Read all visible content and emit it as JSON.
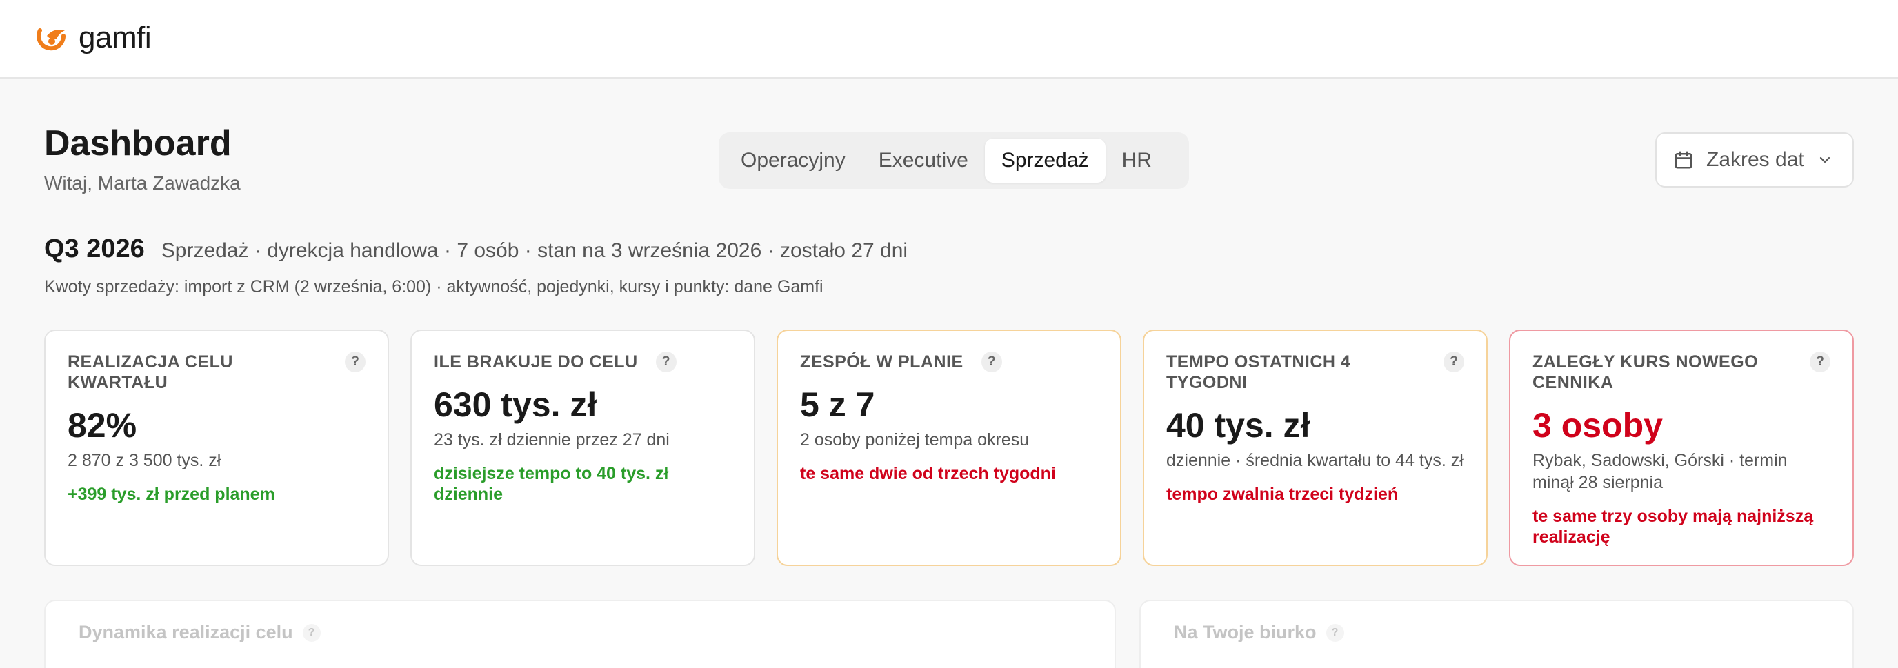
{
  "app": {
    "logo_text": "gamfi",
    "brand_color": "#f07d1a"
  },
  "header": {
    "title": "Dashboard",
    "greeting": "Witaj, Marta Zawadzka"
  },
  "tabs": [
    {
      "label": "Operacyjny",
      "active": false
    },
    {
      "label": "Executive",
      "active": false
    },
    {
      "label": "Sprzedaż",
      "active": true
    },
    {
      "label": "HR",
      "active": false
    }
  ],
  "date_filter": {
    "label": "Zakres dat",
    "icon": "calendar-icon"
  },
  "period": {
    "title": "Q3 2026",
    "meta": "Sprzedaż · dyrekcja handlowa · 7 osób · stan na 3 września 2026 · zostało 27 dni",
    "sources": "Kwoty sprzedaży: import z CRM (2 września, 6:00) · aktywność, pojedynki, kursy i punkty: dane Gamfi"
  },
  "cards": [
    {
      "label": "REALIZACJA CELU KWARTAŁU",
      "value": "82%",
      "sub": "2 870 z 3 500 tys. zł",
      "note": "+399 tys. zł przed planem",
      "tone": "green"
    },
    {
      "label": "ILE BRAKUJE DO CELU",
      "value": "630 tys. zł",
      "sub": "23 tys. zł dziennie przez 27 dni",
      "note": "dzisiejsze tempo to 40 tys. zł dziennie",
      "tone": "green"
    },
    {
      "label": "ZESPÓŁ W PLANIE",
      "value": "5 z 7",
      "sub": "2 osoby poniżej tempa okresu",
      "note": "te same dwie od trzech tygodni",
      "tone": "red"
    },
    {
      "label": "TEMPO OSTATNICH 4 TYGODNI",
      "value": "40 tys. zł",
      "sub": "dziennie · średnia kwartału to 44 tys. zł",
      "note": "tempo zwalnia trzeci tydzień",
      "tone": "red"
    },
    {
      "label": "ZALEGŁY KURS NOWEGO CENNIKA",
      "value": "3 osoby",
      "sub": "Rybak, Sadowski, Górski · termin minął 28 sierpnia",
      "note": "te same trzy osoby mają najniższą realizację",
      "tone": "red"
    }
  ],
  "help_glyph": "?",
  "panels": [
    {
      "title": "Dynamika realizacji celu"
    },
    {
      "title": "Na Twoje biurko"
    }
  ],
  "colors": {
    "success": "#2a9d2a",
    "danger": "#d0021b",
    "warning_border": "#f6d39a",
    "danger_border": "#ef9aa2"
  }
}
